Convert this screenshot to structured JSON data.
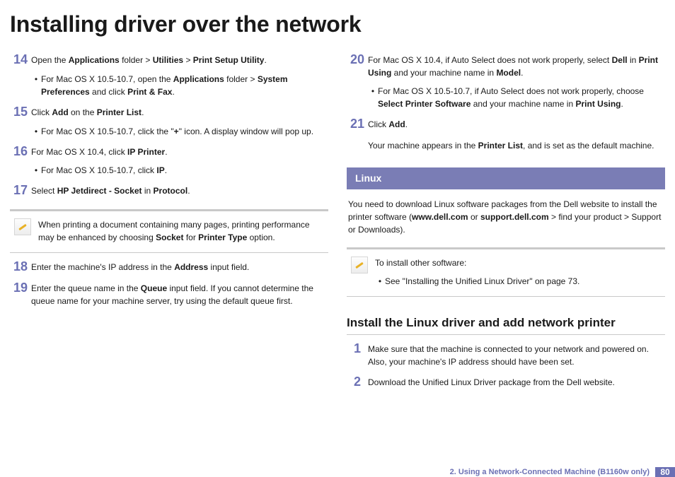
{
  "title": "Installing driver over the network",
  "left": {
    "steps": [
      {
        "n": "14",
        "body": [
          {
            "t": "Open the "
          },
          {
            "b": "Applications"
          },
          {
            "t": " folder > "
          },
          {
            "b": "Utilities"
          },
          {
            "t": " > "
          },
          {
            "b": "Print Setup Utility"
          },
          {
            "t": "."
          }
        ],
        "subs": [
          [
            {
              "t": "For Mac OS X 10.5-10.7, open the "
            },
            {
              "b": "Applications"
            },
            {
              "t": " folder > "
            },
            {
              "b": "System Preferences"
            },
            {
              "t": " and click "
            },
            {
              "b": "Print & Fax"
            },
            {
              "t": "."
            }
          ]
        ]
      },
      {
        "n": "15",
        "body": [
          {
            "t": "Click "
          },
          {
            "b": "Add"
          },
          {
            "t": " on the "
          },
          {
            "b": "Printer List"
          },
          {
            "t": "."
          }
        ],
        "subs": [
          [
            {
              "t": "For Mac OS X 10.5-10.7, click the \""
            },
            {
              "b": "+"
            },
            {
              "t": "\" icon. A display window will pop up."
            }
          ]
        ]
      },
      {
        "n": "16",
        "body": [
          {
            "t": "For Mac OS X 10.4, click "
          },
          {
            "b": "IP Printer"
          },
          {
            "t": "."
          }
        ],
        "subs": [
          [
            {
              "t": "For Mac OS X 10.5-10.7, click "
            },
            {
              "b": "IP"
            },
            {
              "t": "."
            }
          ]
        ]
      },
      {
        "n": "17",
        "body": [
          {
            "t": "Select "
          },
          {
            "b": "HP Jetdirect - Socket"
          },
          {
            "t": " in "
          },
          {
            "b": "Protocol"
          },
          {
            "t": "."
          }
        ],
        "subs": []
      }
    ],
    "note": [
      {
        "t": "When printing a document containing many pages, printing performance may be enhanced by choosing "
      },
      {
        "b": "Socket"
      },
      {
        "t": " for "
      },
      {
        "b": "Printer Type"
      },
      {
        "t": " option."
      }
    ],
    "steps2": [
      {
        "n": "18",
        "body": [
          {
            "t": "Enter the machine's IP address in the "
          },
          {
            "b": "Address"
          },
          {
            "t": " input field."
          }
        ],
        "subs": []
      },
      {
        "n": "19",
        "body": [
          {
            "t": "Enter the queue name in the "
          },
          {
            "b": "Queue"
          },
          {
            "t": " input field. If you cannot determine the queue name for your machine server, try using the default queue first."
          }
        ],
        "subs": []
      }
    ]
  },
  "right": {
    "steps": [
      {
        "n": "20",
        "body": [
          {
            "t": "For Mac OS X 10.4, if Auto Select does not work properly, select "
          },
          {
            "b": "Dell"
          },
          {
            "t": " in "
          },
          {
            "b": "Print Using"
          },
          {
            "t": " and your machine name in "
          },
          {
            "b": "Model"
          },
          {
            "t": "."
          }
        ],
        "subs": [
          [
            {
              "t": "For Mac OS X 10.5-10.7, if Auto Select does not work properly, choose "
            },
            {
              "b": "Select Printer Software"
            },
            {
              "t": " and your machine name in "
            },
            {
              "b": "Print Using"
            },
            {
              "t": "."
            }
          ]
        ]
      },
      {
        "n": "21",
        "body": [
          {
            "t": "Click "
          },
          {
            "b": "Add"
          },
          {
            "t": "."
          }
        ],
        "extra": [
          {
            "t": "Your machine appears in the "
          },
          {
            "b": "Printer List"
          },
          {
            "t": ", and is set as the default machine."
          }
        ],
        "subs": []
      }
    ],
    "section_title": "Linux",
    "linux_para": [
      {
        "t": "You need to download Linux software packages from the Dell website to install the printer software ("
      },
      {
        "b": "www.dell.com"
      },
      {
        "t": " or "
      },
      {
        "b": "support.dell.com"
      },
      {
        "t": " > find your product > Support or Downloads)."
      }
    ],
    "note2_lead": "To install other software:",
    "note2_sub": "See \"Installing the Unified Linux Driver\" on page 73.",
    "subheading": "Install the Linux driver and add network printer",
    "steps2": [
      {
        "n": "1",
        "body": [
          {
            "t": "Make sure that the machine is connected to your network and powered on. Also, your machine's IP address should have been set."
          }
        ],
        "subs": []
      },
      {
        "n": "2",
        "body": [
          {
            "t": "Download the Unified Linux Driver package from the Dell website."
          }
        ],
        "subs": []
      }
    ]
  },
  "footer": {
    "chapter": "2.  Using a Network-Connected Machine (B1160w only)",
    "page": "80"
  }
}
